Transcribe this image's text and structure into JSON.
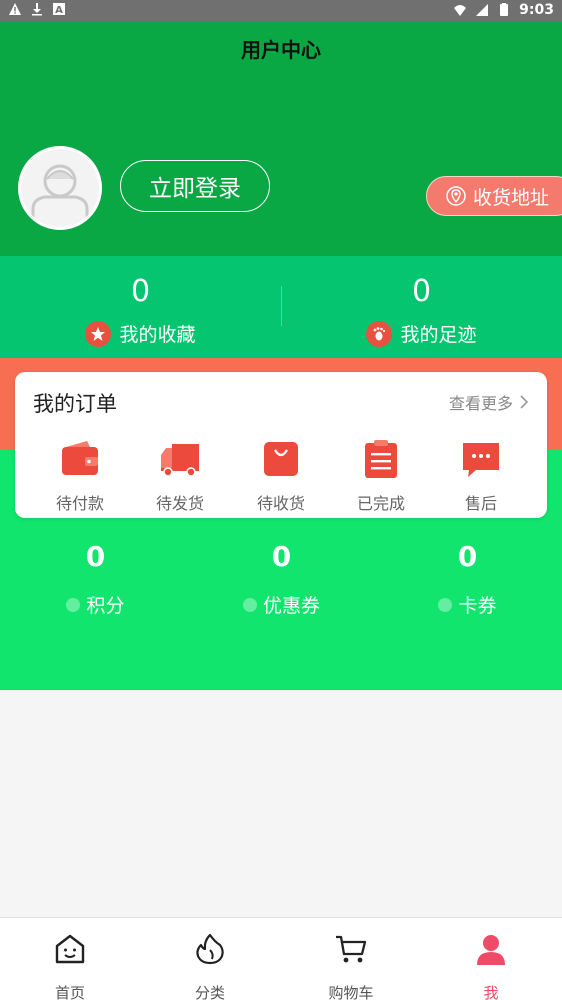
{
  "status_bar": {
    "time": "9:03"
  },
  "header": {
    "title": "用户中心",
    "login_label": "立即登录",
    "address_label": "收货地址"
  },
  "stats": [
    {
      "value": "0",
      "label": "我的收藏",
      "icon": "star-icon"
    },
    {
      "value": "0",
      "label": "我的足迹",
      "icon": "footprint-icon"
    }
  ],
  "orders": {
    "title": "我的订单",
    "more_label": "查看更多",
    "items": [
      {
        "label": "待付款",
        "icon": "wallet-icon"
      },
      {
        "label": "待发货",
        "icon": "truck-icon"
      },
      {
        "label": "待收货",
        "icon": "shopping-bag-icon"
      },
      {
        "label": "已完成",
        "icon": "clipboard-icon"
      },
      {
        "label": "售后",
        "icon": "chat-icon"
      }
    ]
  },
  "points": [
    {
      "value": "0",
      "label": "积分"
    },
    {
      "value": "0",
      "label": "优惠券"
    },
    {
      "value": "0",
      "label": "卡券"
    }
  ],
  "nav": [
    {
      "label": "首页",
      "icon": "home-icon"
    },
    {
      "label": "分类",
      "icon": "category-icon"
    },
    {
      "label": "购物车",
      "icon": "cart-icon"
    },
    {
      "label": "我",
      "icon": "user-icon"
    }
  ],
  "colors": {
    "header_green": "#0aa845",
    "stats_green": "#06c571",
    "orange": "#f86e52",
    "lower_green": "#11e56d",
    "accent_red": "#e8513f",
    "nav_active": "#ef4a67"
  }
}
